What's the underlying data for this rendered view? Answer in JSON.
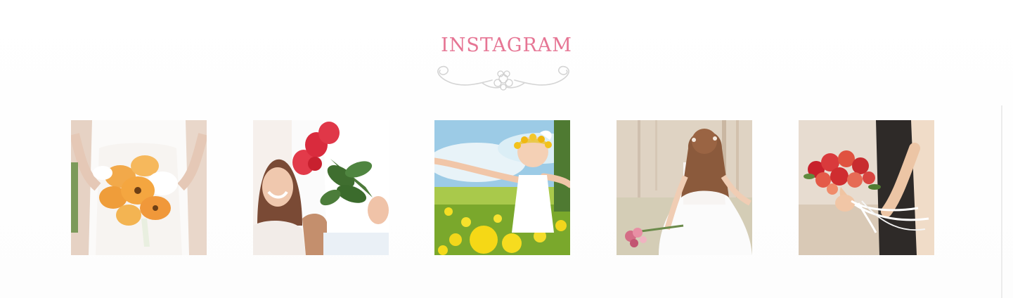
{
  "section": {
    "title": "INSTAGRAM",
    "ornament_icon": "floral-flourish-icon"
  },
  "gallery": {
    "photos": [
      {
        "subject": "bride-holding-orange-calla-lily-bouquet"
      },
      {
        "subject": "woman-smiling-at-man-holding-red-roses"
      },
      {
        "subject": "girl-with-flower-crown-in-yellow-field"
      },
      {
        "subject": "bride-in-white-dress-sitting-with-bouquet"
      },
      {
        "subject": "hands-holding-red-flower-bouquet-with-ribbon"
      }
    ]
  },
  "colors": {
    "accent": "#e67594",
    "ornament": "#cfcfcf",
    "background": "#ffffff"
  }
}
